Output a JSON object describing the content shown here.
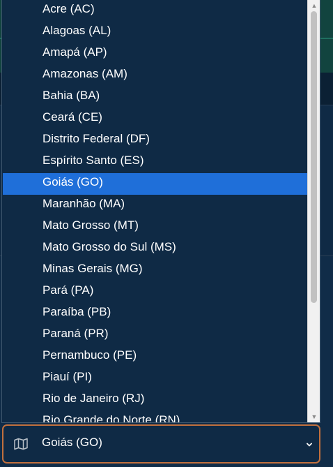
{
  "state_select": {
    "selected_value": "Goiás (GO)",
    "icon": "map-icon",
    "chevron_icon": "chevron-down-icon",
    "accent_border": "#c2703d"
  },
  "dropdown": {
    "options": [
      "Acre (AC)",
      "Alagoas (AL)",
      "Amapá (AP)",
      "Amazonas (AM)",
      "Bahia (BA)",
      "Ceará (CE)",
      "Distrito Federal (DF)",
      "Espírito Santo (ES)",
      "Goiás (GO)",
      "Maranhão (MA)",
      "Mato Grosso (MT)",
      "Mato Grosso do Sul (MS)",
      "Minas Gerais (MG)",
      "Pará (PA)",
      "Paraíba (PB)",
      "Paraná (PR)",
      "Pernambuco (PE)",
      "Piauí (PI)",
      "Rio de Janeiro (RJ)",
      "Rio Grande do Norte (RN)"
    ],
    "selected_index": 8,
    "highlight_color": "#1f6fd9"
  },
  "scrollbar": {
    "up_arrow_icon": "scroll-up-arrow-icon",
    "down_arrow_icon": "scroll-down-arrow-icon"
  }
}
